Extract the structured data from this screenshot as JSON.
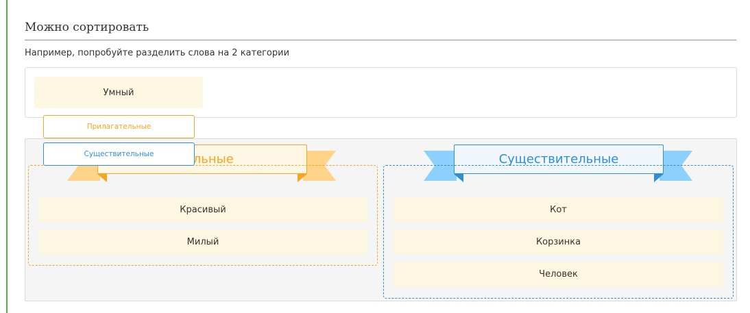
{
  "heading": "Можно сортировать",
  "hint": "Например, попробуйте разделить слова на 2 категории",
  "pool": {
    "words": [
      "Умный"
    ]
  },
  "categories": [
    {
      "title": "Прилагательные",
      "visible_title": "ательные",
      "words": [
        "Красивый",
        "Милый"
      ]
    },
    {
      "title": "Существительные",
      "words": [
        "Кот",
        "Корзинка",
        "Человек"
      ]
    }
  ],
  "menu": {
    "options": [
      "Прилагательные",
      "Существительные"
    ]
  },
  "colors": {
    "accent_left_bar": "#4caf50",
    "adjective": "#f5a623",
    "adjective_ribbon": "#ffd38a",
    "noun": "#2f8fd6",
    "noun_ribbon": "#8dd0fb",
    "card_bg": "#fdf6e1",
    "board_bg": "#f5f5f5"
  }
}
